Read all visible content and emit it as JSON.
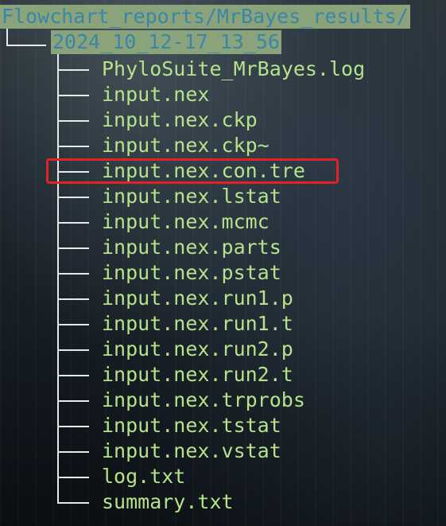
{
  "path": {
    "root": "Flowchart_reports/MrBayes_results/",
    "folder": "2024_10_12-17_13_56"
  },
  "files": [
    "PhyloSuite_MrBayes.log",
    "input.nex",
    "input.nex.ckp",
    "input.nex.ckp~",
    "input.nex.con.tre",
    "input.nex.lstat",
    "input.nex.mcmc",
    "input.nex.parts",
    "input.nex.pstat",
    "input.nex.run1.p",
    "input.nex.run1.t",
    "input.nex.run2.p",
    "input.nex.run2.t",
    "input.nex.trprobs",
    "input.nex.tstat",
    "input.nex.vstat",
    "log.txt",
    "summary.txt"
  ],
  "highlighted_file": "input.nex.con.tre",
  "colors": {
    "path_bg": "#8aa37b",
    "path_text": "#3a86a8",
    "file_text": "#b5e38a",
    "tree_lines": "#e6e9ea",
    "highlight_box": "#e32323"
  }
}
